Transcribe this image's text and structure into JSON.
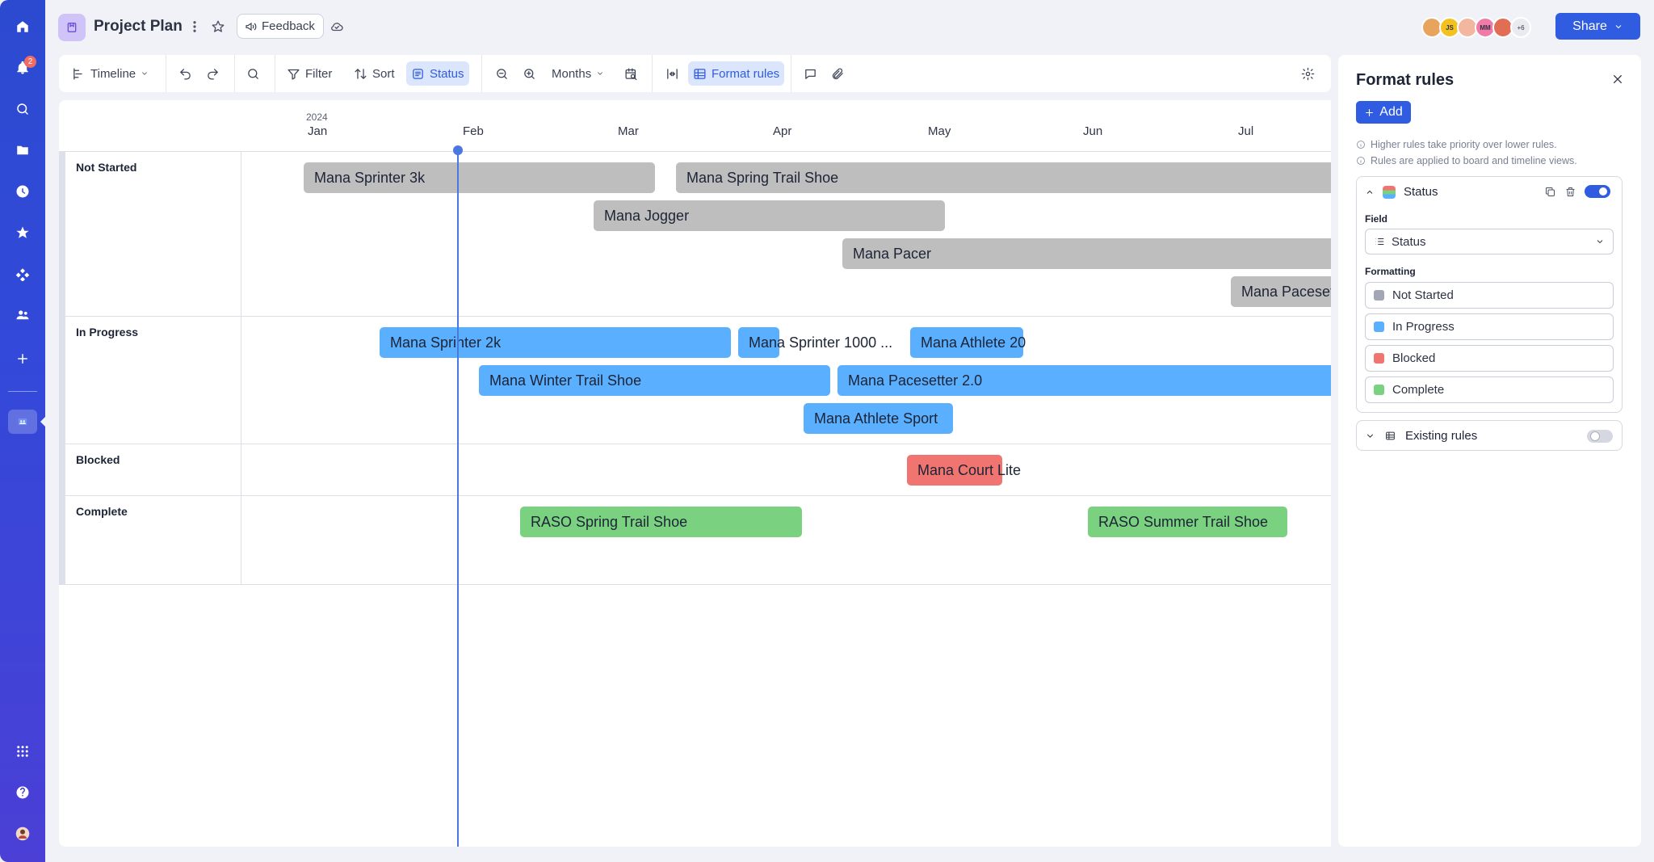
{
  "header": {
    "title": "Project Plan",
    "feedback_label": "Feedback",
    "share_label": "Share",
    "avatars": [
      {
        "initials": "",
        "color": "#e8a45c"
      },
      {
        "initials": "JS",
        "color": "#f4c21f"
      },
      {
        "initials": "",
        "color": "#f3b7a0"
      },
      {
        "initials": "MM",
        "color": "#f07aa8"
      },
      {
        "initials": "",
        "color": "#e06d54"
      }
    ],
    "avatar_overflow": "+6"
  },
  "rail": {
    "notification_count": "2"
  },
  "toolbar": {
    "view_label": "Timeline",
    "filter_label": "Filter",
    "sort_label": "Sort",
    "status_label": "Status",
    "zoom_label": "Months",
    "format_rules_label": "Format rules"
  },
  "timeline": {
    "year": "2024",
    "months": [
      "Jan",
      "Feb",
      "Mar",
      "Apr",
      "May",
      "Jun",
      "Jul"
    ],
    "lanes": [
      {
        "name": "Not Started",
        "color": "#bebebe"
      },
      {
        "name": "In Progress",
        "color": "#5aafff"
      },
      {
        "name": "Blocked",
        "color": "#f07470"
      },
      {
        "name": "Complete",
        "color": "#7ad180"
      }
    ],
    "items": [
      {
        "name": "Mana Sprinter 3k",
        "status": "Not Started"
      },
      {
        "name": "Mana Spring Trail Shoe",
        "status": "Not Started"
      },
      {
        "name": "Mana Jogger",
        "status": "Not Started"
      },
      {
        "name": "Mana Pacer",
        "status": "Not Started"
      },
      {
        "name": "Mana Paceset",
        "status": "Not Started"
      },
      {
        "name": "Mana Sprinter 2k",
        "status": "In Progress"
      },
      {
        "name": "Mana Sprinter 1000 ...",
        "status": "In Progress"
      },
      {
        "name": "Mana Athlete 20",
        "status": "In Progress"
      },
      {
        "name": "Mana Winter Trail Shoe",
        "status": "In Progress"
      },
      {
        "name": "Mana Pacesetter 2.0",
        "status": "In Progress"
      },
      {
        "name": "Mana Athlete Sport",
        "status": "In Progress"
      },
      {
        "name": "Mana Court Lite",
        "status": "Blocked"
      },
      {
        "name": "RASO Spring Trail Shoe",
        "status": "Complete"
      },
      {
        "name": "RASO Summer Trail Shoe",
        "status": "Complete"
      }
    ]
  },
  "panel": {
    "title": "Format rules",
    "add_label": "Add",
    "info": [
      "Higher rules take priority over lower rules.",
      "Rules are applied to board and timeline views."
    ],
    "rule": {
      "name": "Status",
      "enabled": true,
      "field_label": "Field",
      "field_value": "Status",
      "formatting_label": "Formatting",
      "formats": [
        {
          "label": "Not Started",
          "color": "#a3a6b4"
        },
        {
          "label": "In Progress",
          "color": "#5aafff"
        },
        {
          "label": "Blocked",
          "color": "#f07470"
        },
        {
          "label": "Complete",
          "color": "#7ad180"
        }
      ]
    },
    "existing_rules_label": "Existing rules"
  }
}
